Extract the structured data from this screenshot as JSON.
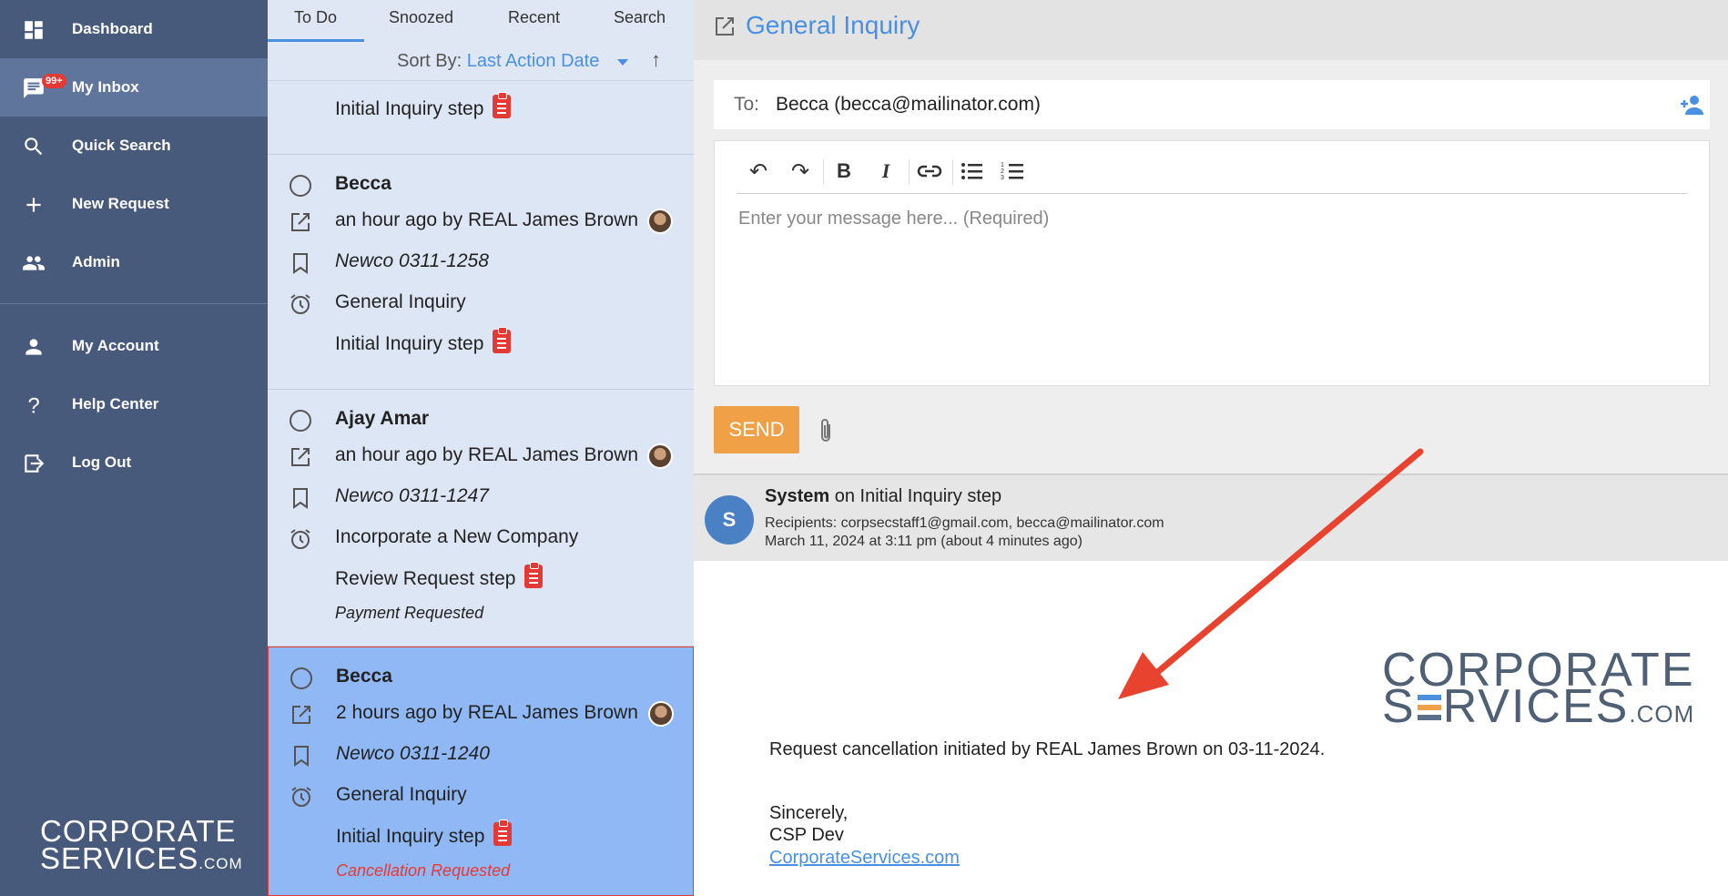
{
  "sidebar": {
    "items": [
      {
        "label": "Dashboard",
        "icon": "dashboard-icon"
      },
      {
        "label": "My Inbox",
        "icon": "inbox-icon",
        "badge": "99+",
        "active": true
      },
      {
        "label": "Quick Search",
        "icon": "search-icon"
      },
      {
        "label": "New Request",
        "icon": "plus-icon"
      },
      {
        "label": "Admin",
        "icon": "people-icon"
      },
      {
        "label": "My Account",
        "icon": "person-icon"
      },
      {
        "label": "Help Center",
        "icon": "question-icon"
      },
      {
        "label": "Log Out",
        "icon": "logout-icon"
      }
    ],
    "logo": {
      "line1": "CORPORATE",
      "line2": "SERVICES",
      "suffix": ".COM"
    }
  },
  "list": {
    "tabs": [
      "To Do",
      "Snoozed",
      "Recent",
      "Search"
    ],
    "sort_label": "Sort By:",
    "sort_value": "Last Action Date",
    "cards": [
      {
        "step": "Initial Inquiry step"
      },
      {
        "name": "Becca",
        "activity": "an hour ago by REAL James Brown",
        "ref": "Newco 0311-1258",
        "type": "General Inquiry",
        "step": "Initial Inquiry step"
      },
      {
        "name": "Ajay Amar",
        "activity": "an hour ago by REAL James Brown",
        "ref": "Newco 0311-1247",
        "type": "Incorporate a New Company",
        "step": "Review Request step",
        "status": "Payment Requested"
      },
      {
        "name": "Becca",
        "activity": "2 hours ago by REAL James Brown",
        "ref": "Newco 0311-1240",
        "type": "General Inquiry",
        "step": "Initial Inquiry step",
        "status": "Cancellation Requested"
      }
    ]
  },
  "detail": {
    "title": "General Inquiry",
    "to_label": "To:",
    "to_value": "Becca (becca@mailinator.com)",
    "editor_placeholder": "Enter your message here... (Required)",
    "send_label": "SEND",
    "message": {
      "avatar_letter": "S",
      "sender": "System",
      "on_step": " on Initial Inquiry step",
      "recipients": "Recipients: corpsecstaff1@gmail.com, becca@mailinator.com",
      "date": "March 11, 2024 at 3:11 pm (about 4 minutes ago)",
      "logo": {
        "line1": "CORPORATE",
        "line2_pre": "S",
        "line2_post": "RVICES",
        "suffix": ".COM"
      },
      "body_line": "Request cancellation initiated by REAL James Brown on 03-11-2024.",
      "closing": "Sincerely,",
      "signature": "CSP Dev",
      "link": "CorporateServices.com"
    }
  },
  "colors": {
    "accent": "#4a90e2",
    "sidebar": "#475a7b",
    "alert": "#e53935",
    "send": "#f0a046",
    "arrow": "#e8432f"
  }
}
